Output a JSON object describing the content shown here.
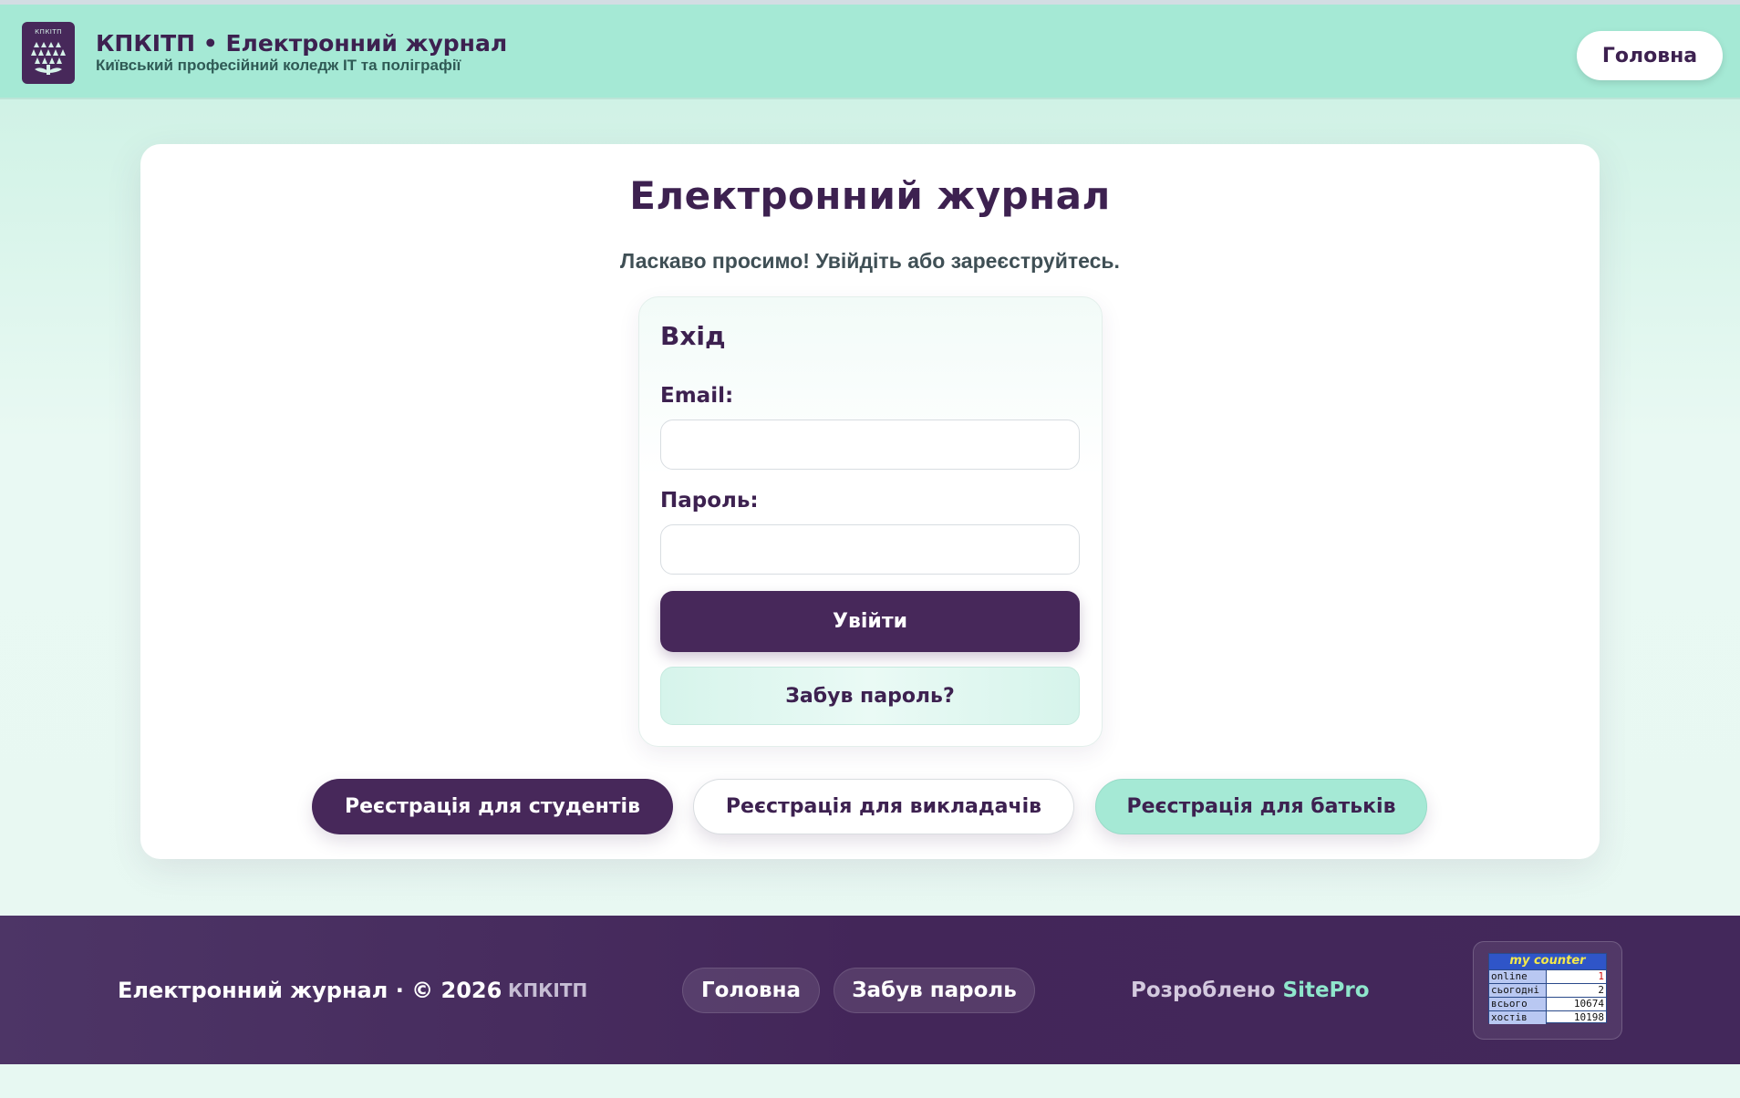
{
  "header": {
    "logo_text": "КПКІТП",
    "title": "КПКІТП • Електронний журнал",
    "subtitle": "Київський професійний коледж ІТ та поліграфії",
    "home_label": "Головна"
  },
  "main": {
    "title": "Електронний журнал",
    "welcome": "Ласкаво просимо! Увійдіть або зареєструйтесь.",
    "login": {
      "title": "Вхід",
      "email_label": "Email:",
      "email_value": "",
      "password_label": "Пароль:",
      "password_value": "",
      "submit_label": "Увійти",
      "forgot_label": "Забув пароль?"
    },
    "register": {
      "students": "Реєстрація для студентів",
      "teachers": "Реєстрація для викладачів",
      "parents": "Реєстрація для батьків"
    }
  },
  "footer": {
    "copyright": "Електронний журнал · © 2026",
    "brand": "КПКІТП",
    "links": [
      "Головна",
      "Забув пароль"
    ],
    "dev_prefix": "Розроблено",
    "dev_name": "SitePro",
    "counter": {
      "title": "my counter",
      "rows": [
        {
          "label": "online",
          "value": "1"
        },
        {
          "label": "сьогодні",
          "value": "2"
        },
        {
          "label": "всього",
          "value": "10674"
        },
        {
          "label": "хостів",
          "value": "10198"
        }
      ]
    }
  },
  "colors": {
    "primary": "#47285a",
    "mint": "#a5e9d5",
    "accent": "#8fe6cc"
  }
}
